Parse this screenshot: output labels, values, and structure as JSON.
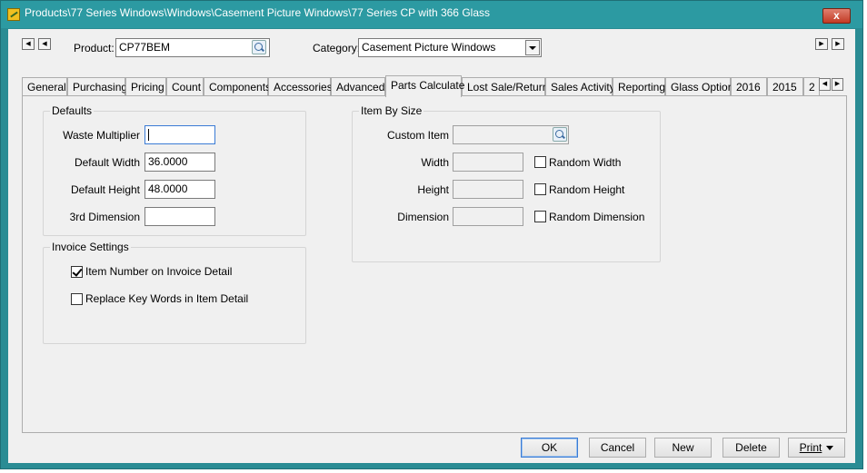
{
  "window": {
    "title": "Products\\77 Series Windows\\Windows\\Casement Picture Windows\\77 Series CP with 366 Glass",
    "close_glyph": "x"
  },
  "nav": {
    "first": "◀",
    "prev": "◀",
    "next": "▶",
    "last": "▶"
  },
  "header": {
    "product_label": "Product:",
    "product_value": "CP77BEM",
    "category_label": "Category:",
    "category_value": "Casement Picture Windows"
  },
  "tabs": [
    "General",
    "Purchasing",
    "Pricing",
    "Count",
    "Components",
    "Accessories",
    "Advanced",
    "Parts Calculate",
    "Lost Sale/Return",
    "Sales Activity",
    "Reporting",
    "Glass Option",
    "2016",
    "2015",
    "2"
  ],
  "active_tab": "Parts Calculate",
  "defaults": {
    "title": "Defaults",
    "waste_multiplier_label": "Waste Multiplier",
    "waste_multiplier_value": "",
    "default_width_label": "Default Width",
    "default_width_value": "36.0000",
    "default_height_label": "Default Height",
    "default_height_value": "48.0000",
    "third_dimension_label": "3rd Dimension",
    "third_dimension_value": ""
  },
  "invoice_settings": {
    "title": "Invoice Settings",
    "item_number_label": "Item Number on Invoice Detail",
    "item_number_checked": true,
    "replace_keywords_label": "Replace Key Words in Item Detail",
    "replace_keywords_checked": false
  },
  "item_by_size": {
    "title": "Item By Size",
    "custom_item_label": "Custom Item",
    "custom_item_value": "",
    "width_label": "Width",
    "width_value": "",
    "height_label": "Height",
    "height_value": "",
    "dimension_label": "Dimension",
    "dimension_value": "",
    "random_width_label": "Random Width",
    "random_height_label": "Random Height",
    "random_dimension_label": "Random Dimension"
  },
  "buttons": {
    "ok": "OK",
    "cancel": "Cancel",
    "new": "New",
    "delete": "Delete",
    "print": "Print"
  },
  "colors": {
    "titlebar": "#2c9aa2",
    "client": "#f0f0f0",
    "default_button_border": "#3a7bd5"
  }
}
